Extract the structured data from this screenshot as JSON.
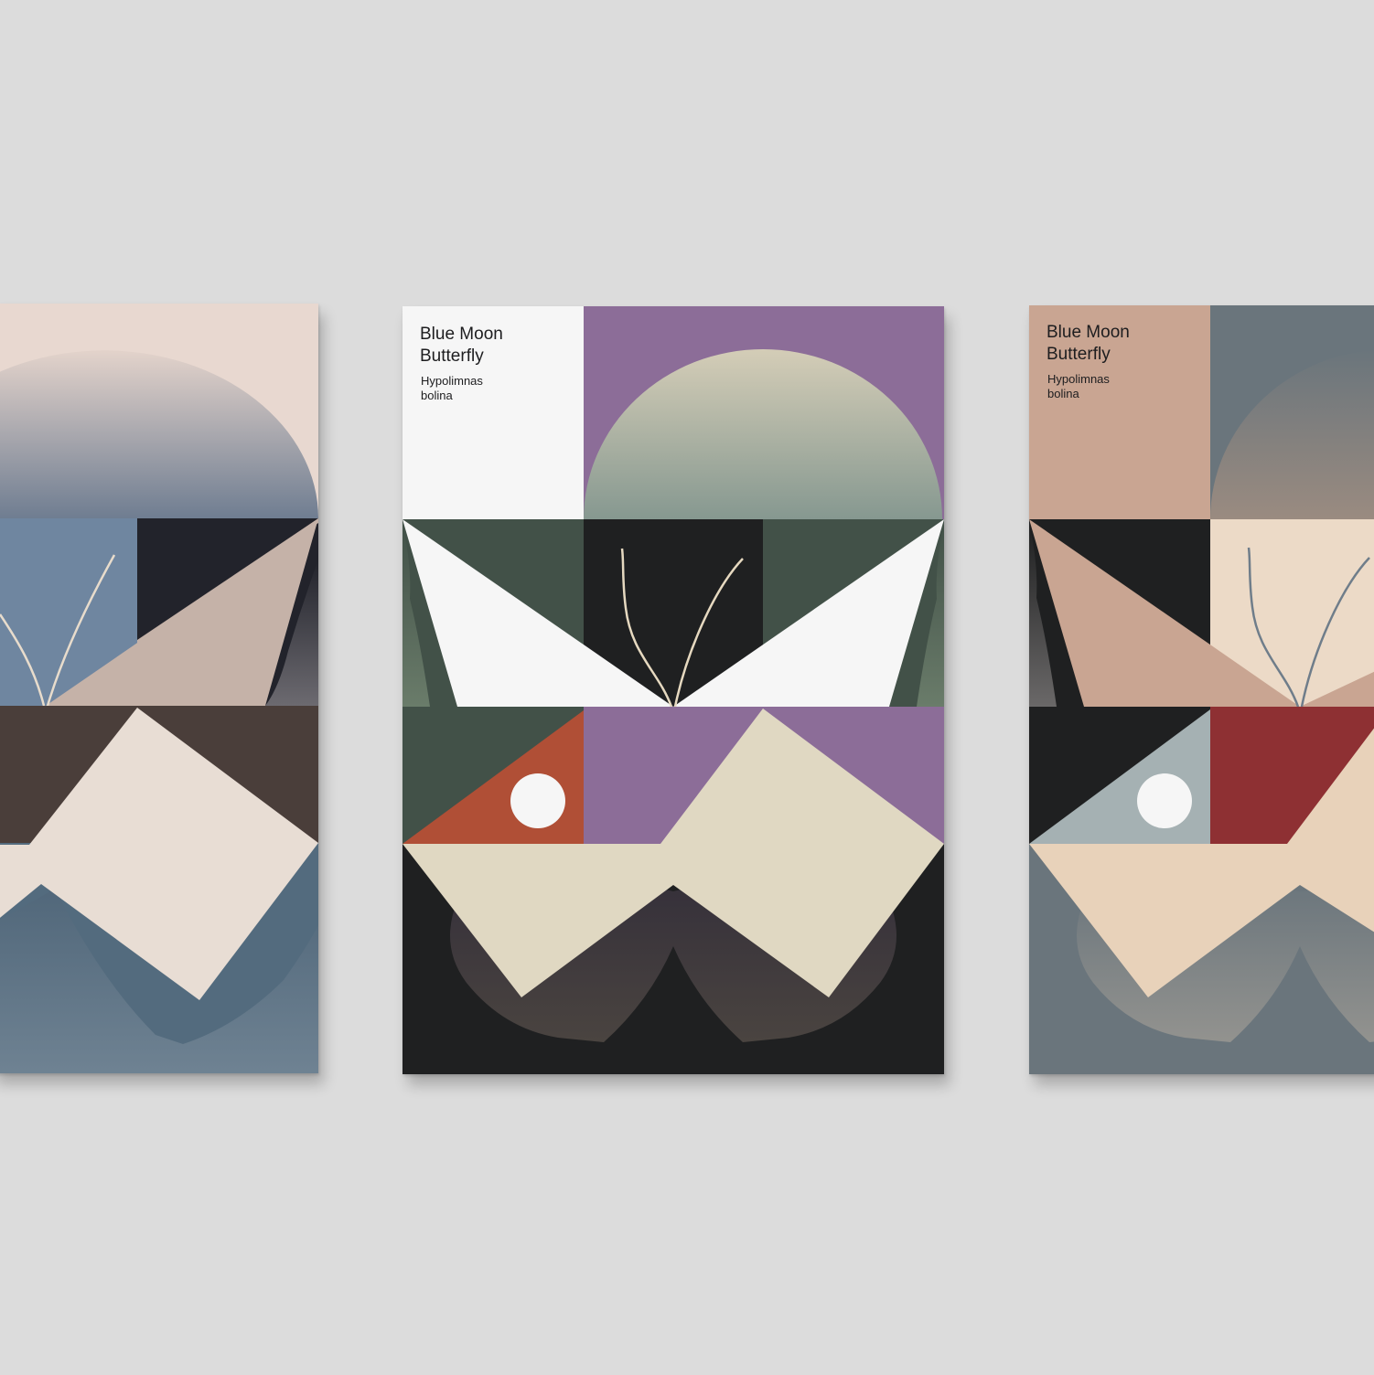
{
  "scene": {
    "background": "#dcdcdc"
  },
  "posters": [
    {
      "id": "left",
      "title": "",
      "subtitle": "",
      "palette": {
        "top": "#e8d8d0",
        "moon_top": "#e3d3cb",
        "moon_bottom": "#6f7d91",
        "mid_left": "#6f86a0",
        "mid_dark": "#22232b",
        "wing_upper": "#c5b2a8",
        "band": "#4a3e3a",
        "diamond": "#e8ddd4",
        "bottom": "#536b7e",
        "shadow_wing": "#7a8a97",
        "antennae": "#e8dccc"
      }
    },
    {
      "id": "center",
      "title": "Blue Moon\nButterfly",
      "subtitle": "Hypolimnas\nbolina",
      "palette": {
        "title_panel": "#f6f6f6",
        "top_right": "#8c6d98",
        "moon_top": "#d4cdb7",
        "moon_bottom": "#869890",
        "green": "#425148",
        "green_wing": "#5a6a5b",
        "dark": "#1f2021",
        "wing_upper": "#f6f6f6",
        "orange": "#b04f36",
        "purple": "#8c6d98",
        "cream": "#e0d8c2",
        "bottom": "#1f2021",
        "shadow_wing_top": "#35303a",
        "shadow_wing_bottom": "#4a4440",
        "dot": "#f6f6f6",
        "antennae": "#e6d9c0"
      }
    },
    {
      "id": "right",
      "title": "Blue Moon\nButterfly",
      "subtitle": "Hypolimnas\nbolina",
      "palette": {
        "title_panel": "#c9a592",
        "top_right": "#6a757c",
        "moon_top": "#6a757c",
        "moon_bottom": "#9a8b80",
        "dark": "#1f2021",
        "wing_upper": "#c9a592",
        "peach": "#ecdac7",
        "grey_blue": "#a5b1b3",
        "red": "#8e3033",
        "cream": "#e8d2ba",
        "bottom": "#6a757c",
        "shadow_wing": "#8d8c88",
        "dot": "#f6f6f6",
        "antennae": "#6f7d8a"
      }
    }
  ]
}
